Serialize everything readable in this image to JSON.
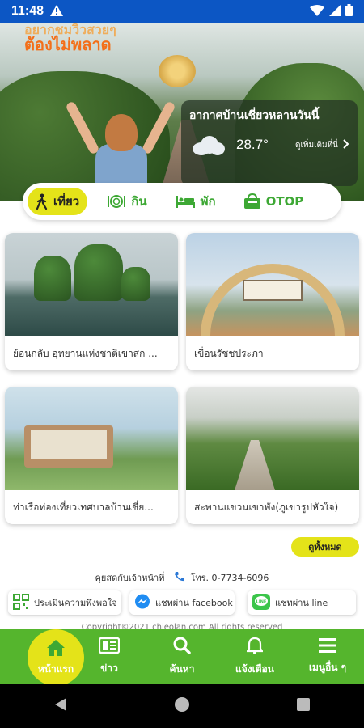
{
  "status": {
    "time": "11:48"
  },
  "hero": {
    "line1": "อยากชมวิวสวยๆ",
    "line2": "ต้องไม่พลาด",
    "weather_title": "อากาศบ้านเชี่ยวหลานวันนี้",
    "temperature": "28.7°",
    "weather_more": "ดูเพิ่มเติมที่นี่"
  },
  "tabs": [
    {
      "label": "เที่ยว",
      "active": true
    },
    {
      "label": "กิน",
      "active": false
    },
    {
      "label": "พัก",
      "active": false
    },
    {
      "label": "OTOP",
      "active": false
    }
  ],
  "places": [
    {
      "label": "ย้อนกลับ อุทยานแห่งชาติเขาสก ..."
    },
    {
      "label": "เขื่อนรัชชประภา"
    },
    {
      "label": "ท่าเรือท่องเที่ยวเทศบาลบ้านเชี่ย..."
    },
    {
      "label": "สะพานแขวนเขาพัง(ภูเขารูปหัวใจ)"
    }
  ],
  "see_all": "ดูทั้งหมด",
  "contact": {
    "title": "คุยสดกับเจ้าหน้าที่",
    "phone": "โทร. 0-7734-6096",
    "buttons": [
      {
        "label": "ประเมินความพึงพอใจ"
      },
      {
        "label": "แชทผ่าน facebook"
      },
      {
        "label": "แชทผ่าน line"
      }
    ]
  },
  "copyright": "Copyright©2021 chieolan.com All rights reserved",
  "bottom_nav": [
    {
      "label": "หน้าแรก",
      "icon": "home-icon"
    },
    {
      "label": "ข่าว",
      "icon": "news-icon"
    },
    {
      "label": "ค้นหา",
      "icon": "search-icon"
    },
    {
      "label": "แจ้งเตือน",
      "icon": "bell-icon"
    },
    {
      "label": "เมนูอื่น ๆ",
      "icon": "menu-icon"
    }
  ],
  "colors": {
    "status_bar": "#0c56c4",
    "accent_yellow": "#e4e319",
    "nav_green": "#55b52d",
    "tab_green": "#3da834"
  }
}
